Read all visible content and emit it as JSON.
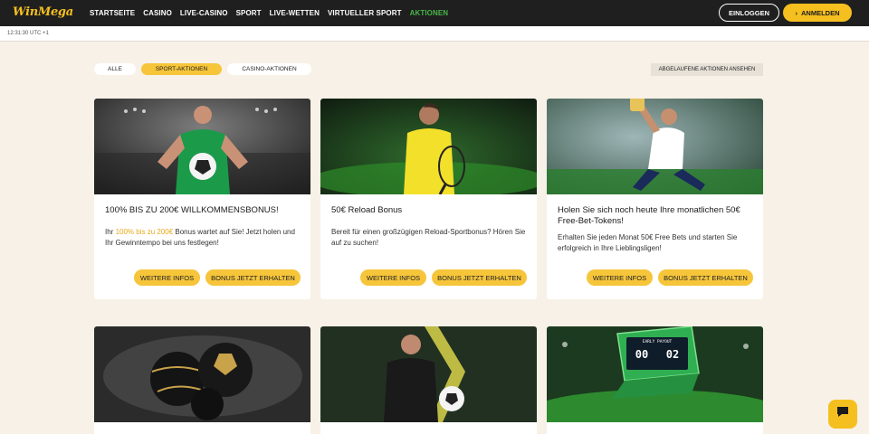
{
  "header": {
    "logo": {
      "win": "Win",
      "mega": "Mega"
    },
    "nav": [
      "STARTSEITE",
      "CASINO",
      "LIVE-CASINO",
      "SPORT",
      "LIVE-WETTEN",
      "VIRTUELLER SPORT",
      "AKTIONEN"
    ],
    "active_nav": "AKTIONEN",
    "login_label": "EINLOGGEN",
    "register_label": "ANMELDEN",
    "register_icon": "chevron-right-icon"
  },
  "clock": "12:31:30 UTC +1",
  "filters": {
    "all": "ALLE",
    "sport": "SPORT-AKTIONEN",
    "casino": "CASINO-AKTIONEN",
    "selected": "SPORT-AKTIONEN"
  },
  "expired_label": "ABGELAUFENE AKTIONEN ANSEHEN",
  "cards": [
    {
      "title": "100% BIS ZU 200€ WILLKOMMENSBONUS!",
      "desc_pre": "Ihr ",
      "desc_hl": "100% bis zu 200€",
      "desc_post": " Bonus wartet auf Sie! Jetzt holen und Ihr Gewinntempo bei uns festlegen!",
      "info_label": "WEITERE INFOS",
      "bonus_label": "BONUS JETZT ERHALTEN"
    },
    {
      "title": "50€ Reload Bonus",
      "desc": "Bereit für einen großzügigen Reload-Sportbonus? Hören Sie auf zu suchen!",
      "info_label": "WEITERE INFOS",
      "bonus_label": "BONUS JETZT ERHALTEN"
    },
    {
      "title": "Holen Sie sich noch heute Ihre monatlichen 50€ Free-Bet-Tokens!",
      "desc": "Erhalten Sie jeden Monat 50€ Free Bets und starten Sie erfolgreich in Ihre Lieblingsligen!",
      "info_label": "WEITERE INFOS",
      "bonus_label": "BONUS JETZT ERHALTEN"
    }
  ],
  "scoreboard": {
    "top": "EARLY PAYOUT",
    "home": "00",
    "away": "02"
  },
  "chat_icon": "chat-bubble-icon",
  "colors": {
    "accent": "#f5bf1f",
    "active_nav": "#48b548",
    "header_bg": "#1f1f1f",
    "page_bg": "#f8f1e7"
  }
}
